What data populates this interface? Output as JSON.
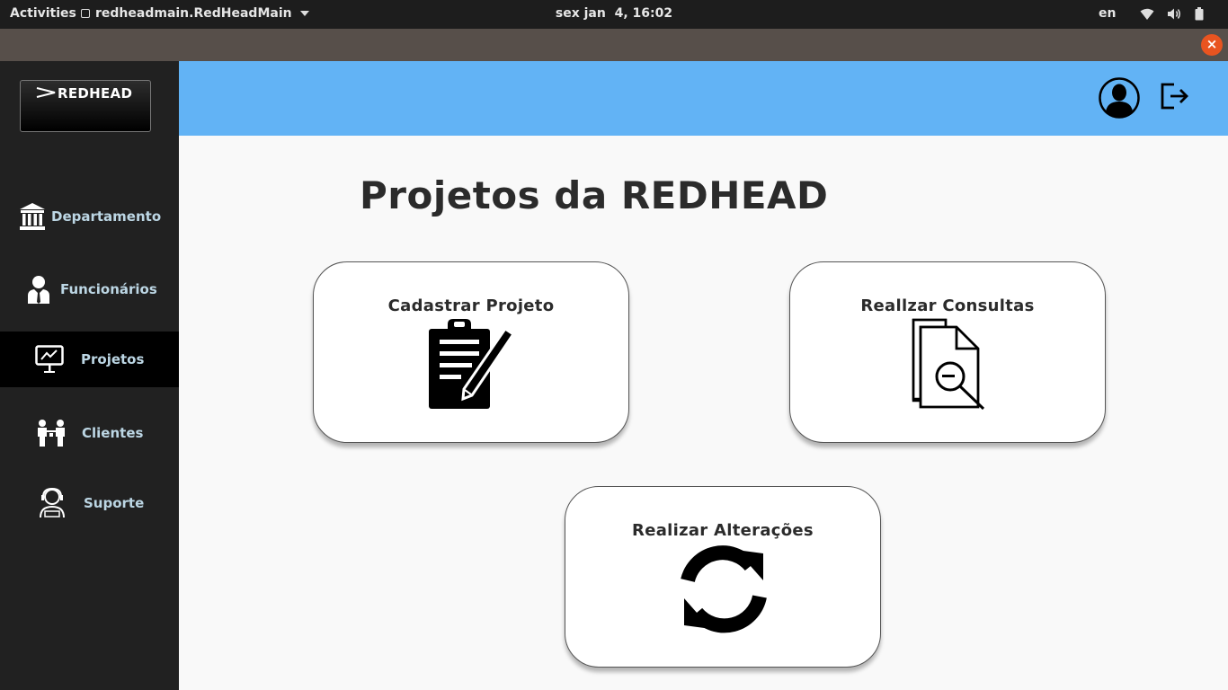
{
  "system_bar": {
    "activities": "Activities",
    "app_name": "redheadmain.RedHeadMain",
    "clock": "sex jan  4, 16:02",
    "language": "en",
    "tray_icons": [
      "wifi-icon",
      "volume-icon",
      "battery-icon"
    ]
  },
  "window": {
    "close_label": "×",
    "close_color": "#e95420",
    "titlebar_color": "#574f4a"
  },
  "sidebar": {
    "logo_text": "REDHEAD",
    "items": [
      {
        "label": "Departamento",
        "icon": "bank-icon",
        "active": false
      },
      {
        "label": "Funcionários",
        "icon": "employee-icon",
        "active": false
      },
      {
        "label": "Projetos",
        "icon": "presentation-icon",
        "active": true
      },
      {
        "label": "Clientes",
        "icon": "clients-icon",
        "active": false
      },
      {
        "label": "Suporte",
        "icon": "support-icon",
        "active": false
      }
    ]
  },
  "header": {
    "color": "#62b3f5",
    "icons": [
      "user-avatar-icon",
      "logout-icon"
    ]
  },
  "main": {
    "title": "Projetos da REDHEAD",
    "cards": [
      {
        "label": "Cadastrar Projeto",
        "icon": "clipboard-pen-icon"
      },
      {
        "label": "Reallzar Consultas",
        "icon": "document-search-icon"
      },
      {
        "label": "Realizar Alterações",
        "icon": "refresh-icon"
      }
    ]
  }
}
